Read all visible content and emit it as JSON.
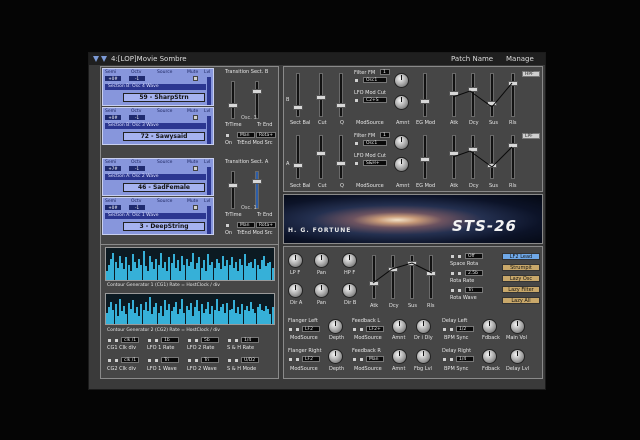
{
  "titlebar": {
    "program": "4:[LOP]Movie Sombre",
    "patch_name": "Patch Name",
    "manage": "Manage"
  },
  "sections": {
    "headers": {
      "semi": "Semi",
      "octv": "Octv",
      "source": "Source",
      "mute": "Mute",
      "lvl": "Lvl"
    },
    "b4": {
      "semi": "+0#",
      "octv": "-1",
      "title": "Section B: Osc 4 Wave",
      "name": "59 - SharpStrn"
    },
    "b3": {
      "semi": "+0#",
      "octv": "-1",
      "title": "Section B: Osc 3 Wave",
      "name": "72 - Sawysaid"
    },
    "a2": {
      "semi": "+7#",
      "octv": "-1",
      "title": "Section A: Osc 2 Wave",
      "name": "46 - SadFemale"
    },
    "a1": {
      "semi": "+0#",
      "octv": "-1",
      "title": "Section A: Osc 1 Wave",
      "name": "3 - DeepString"
    }
  },
  "transition_b": {
    "title": "Transition Sect. B",
    "osc": "Osc. 3",
    "trtime": "TrTime",
    "trend": "Tr End",
    "on": "On",
    "mode_label": "TrEnd Mod Src",
    "mode": "Man",
    "mod_src": "Rota+"
  },
  "transition_a": {
    "title": "Transition Sect. A",
    "osc": "Osc. 1",
    "trtime": "TrTime",
    "trend": "Tr End",
    "on": "On",
    "mode_label": "TrEnd Mod Src",
    "mode": "Man",
    "mod_src": "Rota+"
  },
  "filter_b": {
    "side": "B",
    "bal": "Sect Bal",
    "cut": "Cut",
    "q": "Q",
    "fm": "Filter FM",
    "fm_val": "1",
    "fm_src": "Osc1",
    "lfo": "LFO Mod Cut",
    "lfo_src": "C2+S",
    "modsource": "ModSource",
    "amnt": "Amnt",
    "egmod": "EG Mod",
    "atk": "Atk",
    "dcy": "Dcy",
    "sus": "Sus",
    "rls": "Rls",
    "type": "HPF"
  },
  "filter_a": {
    "side": "A",
    "bal": "Sect Bal",
    "cut": "Cut",
    "q": "Q",
    "fm": "Filter FM",
    "fm_val": "1",
    "fm_src": "Osc1",
    "lfo": "LFO Mod Cut",
    "lfo_src": "S&H+",
    "modsource": "ModSource",
    "amnt": "Amnt",
    "egmod": "EG Mod",
    "atk": "Atk",
    "dcy": "Dcy",
    "sus": "Sus",
    "rls": "Rls",
    "type": "LPF"
  },
  "banner": {
    "brand": "H. G. FORTUNE",
    "model": "STS-26"
  },
  "cg1": {
    "label": "Contour Generator 1 (CG1)  Rate = HostClock / div",
    "values": [
      0.3,
      0.5,
      0.7,
      0.9,
      0.6,
      0.4,
      0.8,
      0.55,
      0.35,
      0.75,
      0.5,
      0.3,
      0.85,
      0.6,
      0.4,
      0.7,
      0.5,
      0.95,
      0.45,
      0.3,
      0.8,
      0.6,
      0.35,
      0.7,
      0.5,
      0.9,
      0.4,
      0.6,
      0.3,
      0.75,
      0.55,
      0.85,
      0.4,
      0.65,
      0.3,
      0.8,
      0.5,
      0.7,
      0.45,
      0.6,
      0.9,
      0.35,
      0.55,
      0.75,
      0.4,
      0.65,
      0.3,
      0.85,
      0.5,
      0.6,
      0.4,
      0.7,
      0.55,
      0.35,
      0.8,
      0.45,
      0.65,
      0.5,
      0.75,
      0.4,
      0.6,
      0.3,
      0.7,
      0.5,
      0.85,
      0.45,
      0.55,
      0.6,
      0.4,
      0.7,
      0.5,
      0.35,
      0.65,
      0.8,
      0.45,
      0.55,
      0.6,
      0.4
    ]
  },
  "cg2": {
    "label": "Contour Generator 2 (CG2)  Rate = HostClock / div",
    "values": [
      0.4,
      0.6,
      0.8,
      0.5,
      0.7,
      0.3,
      0.9,
      0.45,
      0.65,
      0.35,
      0.75,
      0.55,
      0.85,
      0.4,
      0.6,
      0.3,
      0.7,
      0.5,
      0.8,
      0.45,
      0.95,
      0.35,
      0.6,
      0.75,
      0.4,
      0.65,
      0.3,
      0.85,
      0.5,
      0.7,
      0.45,
      0.6,
      0.8,
      0.35,
      0.55,
      0.9,
      0.4,
      0.65,
      0.5,
      0.75,
      0.3,
      0.6,
      0.85,
      0.45,
      0.7,
      0.4,
      0.55,
      0.8,
      0.35,
      0.65,
      0.5,
      0.9,
      0.45,
      0.6,
      0.7,
      0.4,
      0.75,
      0.5,
      0.55,
      0.85,
      0.4,
      0.6,
      0.35,
      0.7,
      0.5,
      0.65,
      0.45,
      0.8,
      0.55,
      0.4,
      0.6,
      0.7,
      0.5,
      0.45,
      0.65,
      0.55,
      0.35,
      0.6
    ]
  },
  "lfo": {
    "cg1_clk": "clk /1",
    "cg1_clk_label": "CG1 Clk div",
    "lfo1_rate": "1b",
    "lfo1_rate_label": "LFO 1 Rate",
    "lfo2_rate": "5b",
    "lfo2_rate_label": "LFO 2 Rate",
    "sh_rate": "1/4",
    "sh_rate_label": "S & H Rate",
    "cg2_clk": "clk /1",
    "cg2_clk_label": "CG2 Clk div",
    "lfo1_wave": "Tri",
    "lfo1_wave_label": "LFO 1 Wave",
    "lfo2_wave": "Tri",
    "lfo2_wave_label": "LFO 2 Wave",
    "sh_mode": "U/D2",
    "sh_mode_label": "S & H Mode"
  },
  "amp": {
    "lpf": "LP F",
    "pan1": "Pan",
    "hpf": "HP F",
    "dirA": "Dir A",
    "pan2": "Pan",
    "dirB": "Dir B",
    "atk": "Atk",
    "dcy": "Dcy",
    "sus": "Sus",
    "rls": "Rls",
    "space": "Space Rota",
    "space_val": "Off",
    "rota_rate_val": "2.5b",
    "rota_rate": "Rota Rate",
    "rota_wave_val": "Tri",
    "rota_wave": "Rota Wave"
  },
  "lfo_buttons": [
    "LF2 Lead",
    "Strumpit",
    "Lazy Osc",
    "Lazy Filter",
    "Lazy All"
  ],
  "fx_left": {
    "flanger": "Flanger Left",
    "fl_src": "LF2",
    "depth": "Depth",
    "modsource": "ModSource",
    "feedback": "Feedback L",
    "fb_src": "LF2+",
    "amnt": "Amnt",
    "dly": "Dr i Dly",
    "delay": "Delay Left",
    "d_val": "1/2",
    "bpm": "BPM Sync",
    "fdback": "Fdback",
    "main": "Main Vol"
  },
  "fx_right": {
    "flanger": "Flanger Right",
    "fl_src": "LF2",
    "depth": "Depth",
    "modsource": "ModSource",
    "feedback": "Feedback R",
    "fb_src": "Man",
    "amnt": "Amnt",
    "dly": "Fbg Lvl",
    "delay": "Delay Right",
    "d_val": "1/4",
    "bpm": "BPM Sync",
    "fdback": "Fdback",
    "main": "Delay Lvl"
  }
}
